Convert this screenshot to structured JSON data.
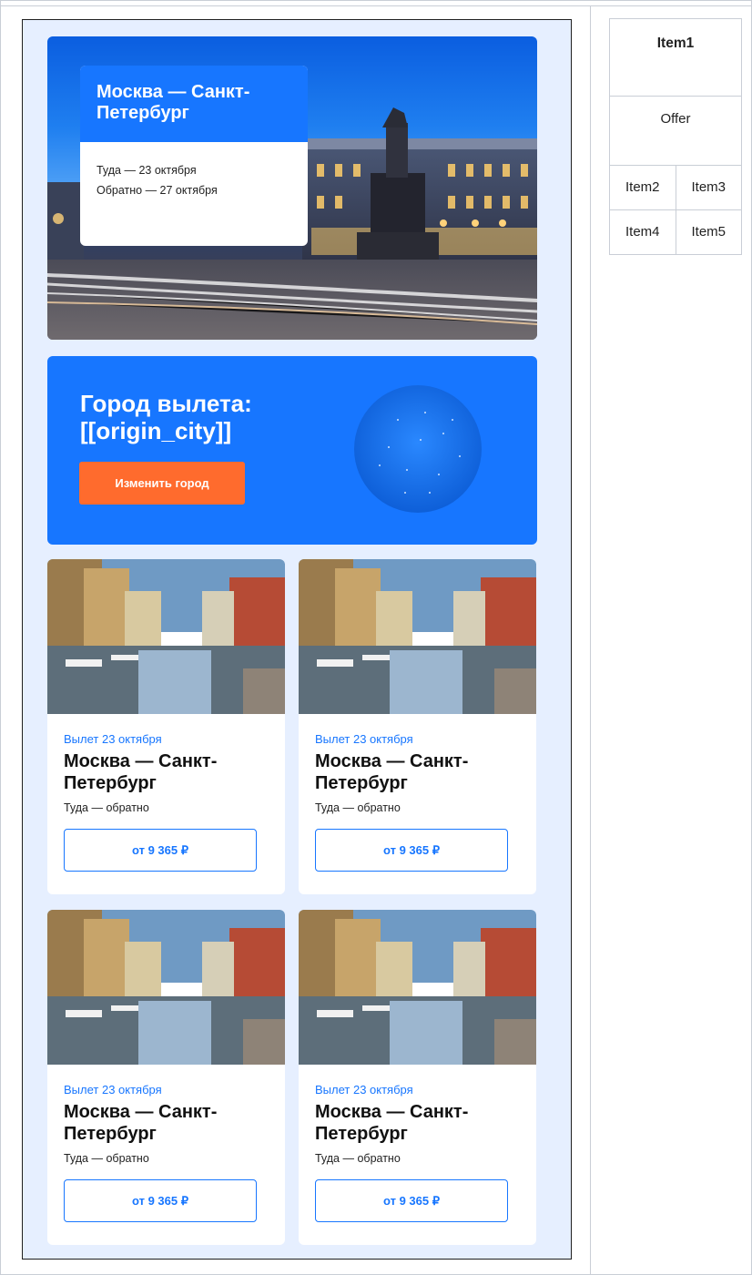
{
  "hero": {
    "title": "Москва — Санкт-Петербург",
    "outbound": "Туда — 23 октября",
    "return": "Обратно — 27 октября"
  },
  "origin": {
    "title": "Город вылета: [[origin_city]]",
    "change_button": "Изменить город"
  },
  "offers": [
    {
      "date": "Вылет 23 октября",
      "title": "Москва — Санкт-Петербург",
      "subtitle": "Туда — обратно",
      "price": "от 9 365 ₽"
    },
    {
      "date": "Вылет 23 октября",
      "title": "Москва — Санкт-Петербург",
      "subtitle": "Туда — обратно",
      "price": "от 9 365 ₽"
    },
    {
      "date": "Вылет 23 октября",
      "title": "Москва — Санкт-Петербург",
      "subtitle": "Туда — обратно",
      "price": "от 9 365 ₽"
    },
    {
      "date": "Вылет 23 октября",
      "title": "Москва — Санкт-Петербург",
      "subtitle": "Туда — обратно",
      "price": "от 9 365 ₽"
    }
  ],
  "layout_table": {
    "item1": "Item1",
    "offer": "Offer",
    "item2": "Item2",
    "item3": "Item3",
    "item4": "Item4",
    "item5": "Item5"
  },
  "colors": {
    "accent": "#1776ff",
    "button_orange": "#ff6b2d",
    "email_bg": "#e6efff"
  }
}
